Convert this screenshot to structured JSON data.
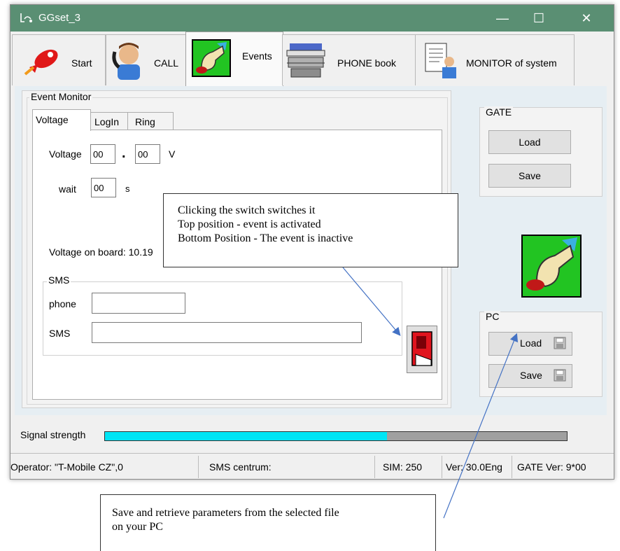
{
  "window": {
    "title": "GGset_3",
    "controls": {
      "minimize": "—",
      "maximize": "☐",
      "close": "✕"
    }
  },
  "tabs": [
    {
      "label": "Start",
      "icon": "rocket-icon"
    },
    {
      "label": "CALL",
      "icon": "phone-caller-icon"
    },
    {
      "label": "Events",
      "icon": "hand-switch-icon",
      "active": true
    },
    {
      "label": "PHONE book",
      "icon": "phone-book-icon"
    },
    {
      "label": "MONITOR of system",
      "icon": "monitor-document-icon"
    }
  ],
  "event_monitor": {
    "title": "Event Monitor",
    "subtabs": [
      "Voltage",
      "LogIn",
      "Ring"
    ],
    "voltage_label": "Voltage",
    "voltage_int": "00",
    "voltage_dot": ".",
    "voltage_dec": "00",
    "voltage_unit": "V",
    "wait_label": "wait",
    "wait_value": "00",
    "wait_unit": "s",
    "voltage_on_board": "Voltage on board: 10.19",
    "sms_group": "SMS",
    "phone_label": "phone",
    "phone_value": "",
    "sms_label": "SMS",
    "sms_value": ""
  },
  "gate": {
    "title": "GATE",
    "load": "Load",
    "save": "Save"
  },
  "pc": {
    "title": "PC",
    "load": "Load",
    "save": "Save"
  },
  "signal": {
    "label": "Signal strength",
    "level": 0.61,
    "fill_color": "#00e5f5",
    "empty_color": "#a0a0a0"
  },
  "status_bar": {
    "operator": "Operator: \"T-Mobile CZ\",0",
    "sms_centrum": "SMS centrum:",
    "sim": "SIM: 250",
    "ver": "Ver: 30.0Eng",
    "gate_ver": "GATE Ver: 9*00"
  },
  "callouts": {
    "switch_lines": [
      "Clicking the switch switches it",
      "Top position - event is activated",
      "Bottom Position - The event is inactive"
    ],
    "pc_lines": [
      "Save and retrieve parameters from the selected file",
      "on your PC"
    ]
  },
  "colors": {
    "titlebar": "#5a8f73",
    "switch_red": "#e0141e",
    "icon_green": "#22c422"
  }
}
